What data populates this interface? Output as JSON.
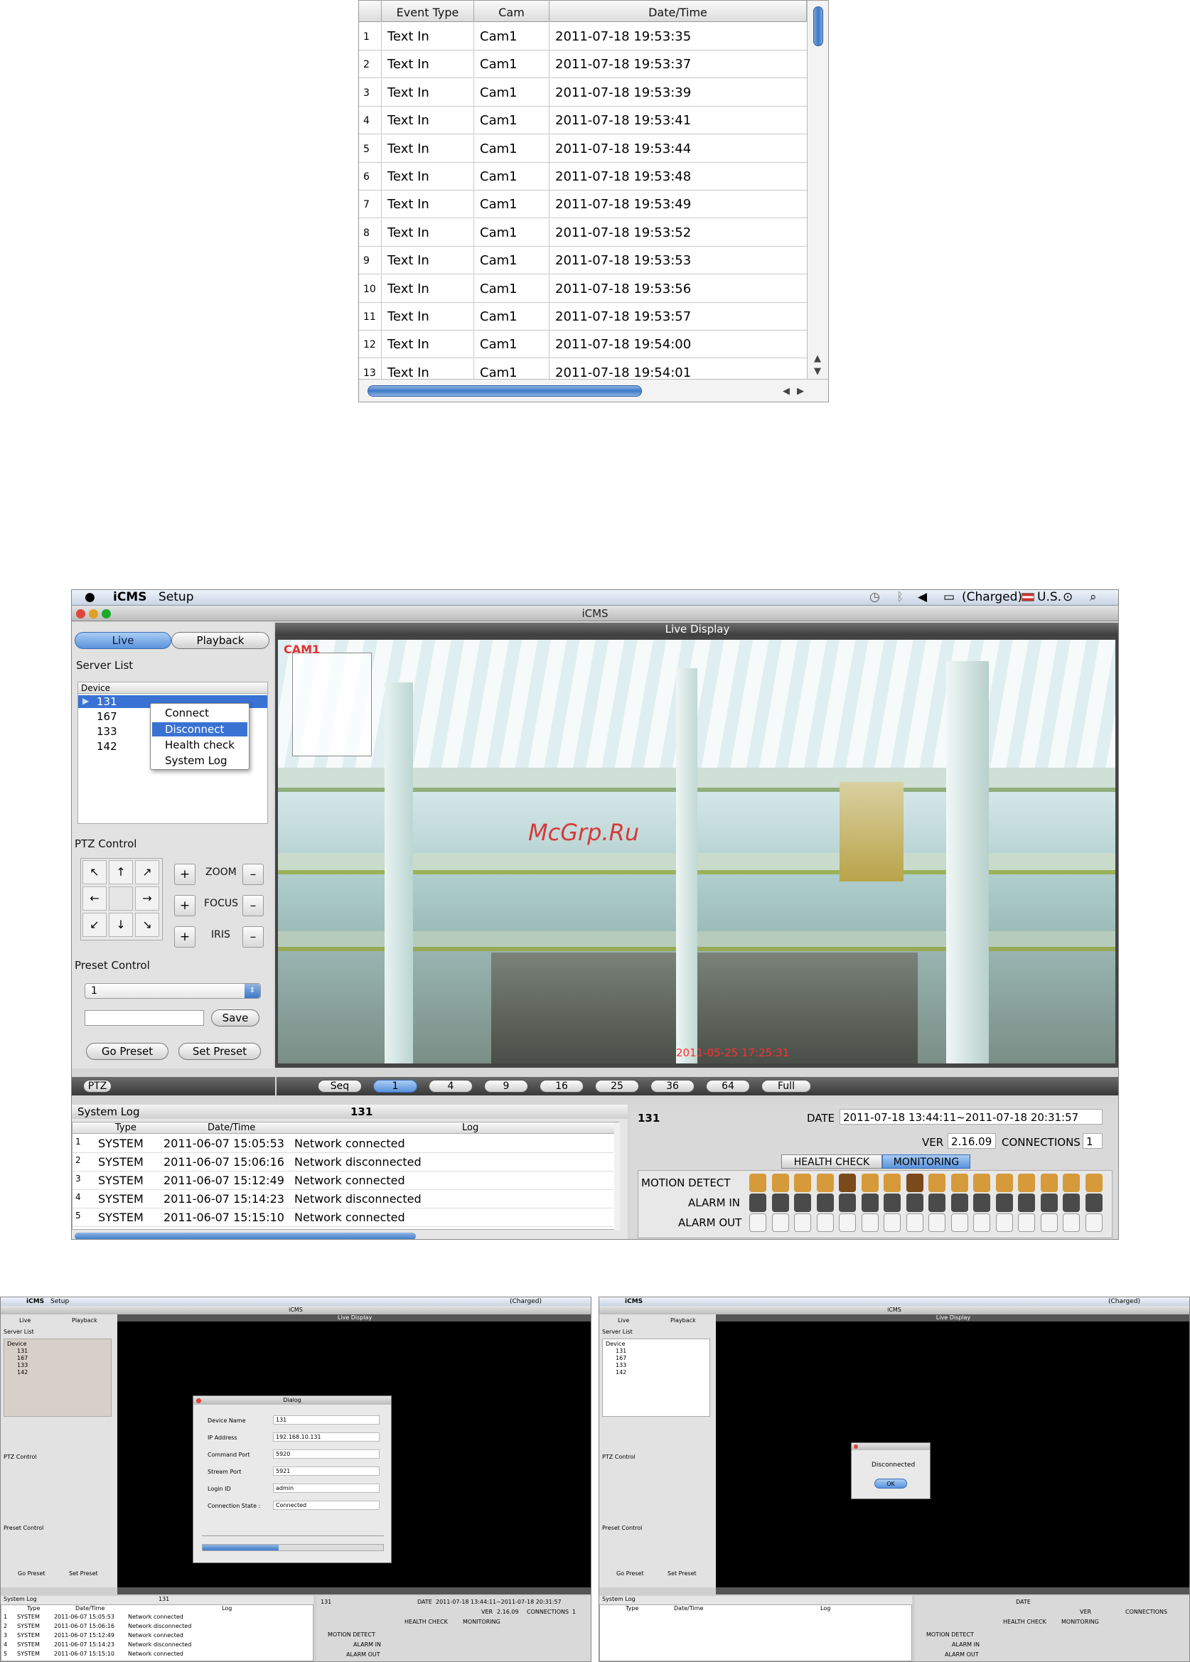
{
  "event_table": {
    "headers": {
      "num": "",
      "event_type": "Event Type",
      "cam": "Cam",
      "datetime": "Date/Time"
    },
    "rows": [
      {
        "n": "1",
        "event": "Text In",
        "cam": "Cam1",
        "dt": "2011-07-18 19:53:35"
      },
      {
        "n": "2",
        "event": "Text In",
        "cam": "Cam1",
        "dt": "2011-07-18 19:53:37"
      },
      {
        "n": "3",
        "event": "Text In",
        "cam": "Cam1",
        "dt": "2011-07-18 19:53:39"
      },
      {
        "n": "4",
        "event": "Text In",
        "cam": "Cam1",
        "dt": "2011-07-18 19:53:41"
      },
      {
        "n": "5",
        "event": "Text In",
        "cam": "Cam1",
        "dt": "2011-07-18 19:53:44"
      },
      {
        "n": "6",
        "event": "Text In",
        "cam": "Cam1",
        "dt": "2011-07-18 19:53:48"
      },
      {
        "n": "7",
        "event": "Text In",
        "cam": "Cam1",
        "dt": "2011-07-18 19:53:49"
      },
      {
        "n": "8",
        "event": "Text In",
        "cam": "Cam1",
        "dt": "2011-07-18 19:53:52"
      },
      {
        "n": "9",
        "event": "Text In",
        "cam": "Cam1",
        "dt": "2011-07-18 19:53:53"
      },
      {
        "n": "10",
        "event": "Text In",
        "cam": "Cam1",
        "dt": "2011-07-18 19:53:56"
      },
      {
        "n": "11",
        "event": "Text In",
        "cam": "Cam1",
        "dt": "2011-07-18 19:53:57"
      },
      {
        "n": "12",
        "event": "Text In",
        "cam": "Cam1",
        "dt": "2011-07-18 19:54:00"
      },
      {
        "n": "13",
        "event": "Text In",
        "cam": "Cam1",
        "dt": "2011-07-18 19:54:01"
      }
    ]
  },
  "main": {
    "menubar": {
      "app": "iCMS",
      "menu": "Setup",
      "battery": "(Charged)",
      "locale": "U.S."
    },
    "window_title": "iCMS",
    "tabs": {
      "live": "Live",
      "playback": "Playback"
    },
    "server_list_label": "Server List",
    "device_header": "Device",
    "devices": [
      "131",
      "167",
      "133",
      "142"
    ],
    "context_menu": [
      "Connect",
      "Disconnect",
      "Health check",
      "System Log"
    ],
    "ptz_label": "PTZ Control",
    "ptz_arrows": [
      "↖",
      "↑",
      "↗",
      "←",
      "",
      "→",
      "↙",
      "↓",
      "↘"
    ],
    "ptz_rows": {
      "zoom": "ZOOM",
      "focus": "FOCUS",
      "iris": "IRIS",
      "plus": "+",
      "minus": "–"
    },
    "preset_label": "Preset Control",
    "preset_value": "1",
    "save": "Save",
    "go_preset": "Go Preset",
    "set_preset": "Set Preset",
    "live_display": "Live Display",
    "cam_label": "CAM1",
    "watermark": "McGrp.Ru",
    "cam_time": "2011-05-25 17:25:31",
    "ptz_tag": "PTZ",
    "split_buttons": [
      "Seq",
      "1",
      "4",
      "9",
      "16",
      "25",
      "36",
      "64",
      "Full"
    ],
    "system_log_title": "System Log",
    "log_server": "131",
    "log_headers": {
      "type": "Type",
      "dt": "Date/Time",
      "log": "Log"
    },
    "log_rows": [
      {
        "n": "1",
        "type": "SYSTEM",
        "dt": "2011-06-07 15:05:53",
        "log": "Network connected"
      },
      {
        "n": "2",
        "type": "SYSTEM",
        "dt": "2011-06-07 15:06:16",
        "log": "Network disconnected"
      },
      {
        "n": "3",
        "type": "SYSTEM",
        "dt": "2011-06-07 15:12:49",
        "log": "Network connected"
      },
      {
        "n": "4",
        "type": "SYSTEM",
        "dt": "2011-06-07 15:14:23",
        "log": "Network disconnected"
      },
      {
        "n": "5",
        "type": "SYSTEM",
        "dt": "2011-06-07 15:15:10",
        "log": "Network connected"
      }
    ],
    "status": {
      "server": "131",
      "date_label": "DATE",
      "date_value": "2011-07-18 13:44:11~2011-07-18 20:31:57",
      "ver_label": "VER",
      "ver_value": "2.16.09",
      "conn_label": "CONNECTIONS",
      "conn_value": "1",
      "tab_health": "HEALTH CHECK",
      "tab_monitoring": "MONITORING",
      "motion": "MOTION DETECT",
      "alarm_in": "ALARM IN",
      "alarm_out": "ALARM OUT"
    }
  },
  "left_shot": {
    "dialog_title": "Dialog",
    "fields": [
      {
        "label": "Device Name",
        "value": "131"
      },
      {
        "label": "IP Address",
        "value": "192.168.10.131"
      },
      {
        "label": "Command Port",
        "value": "5920"
      },
      {
        "label": "Stream Port",
        "value": "5921"
      },
      {
        "label": "Login ID",
        "value": "admin"
      },
      {
        "label": "Connection State :",
        "value": "Connected"
      }
    ]
  },
  "right_shot": {
    "alert_text": "Disconnected",
    "ok": "OK"
  }
}
